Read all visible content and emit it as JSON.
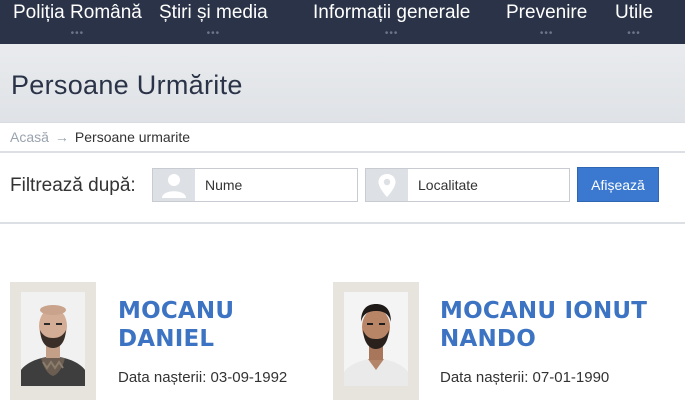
{
  "nav": {
    "items": [
      {
        "label": "Poliția Română"
      },
      {
        "label": "Știri și media"
      },
      {
        "label": "Informații generale"
      },
      {
        "label": "Prevenire"
      },
      {
        "label": "Utile"
      }
    ],
    "dots": "•••"
  },
  "page": {
    "title": "Persoane Urmărite"
  },
  "breadcrumb": {
    "home": "Acasă",
    "separator": "→",
    "current": "Persoane urmarite"
  },
  "filter": {
    "label": "Filtrează după:",
    "name_placeholder": "Nume",
    "locality_placeholder": "Localitate",
    "button_label": "Afișează"
  },
  "persons": [
    {
      "name_line1": "MOCANU",
      "name_line2": "DANIEL",
      "dob_label": "Data nașterii:",
      "dob": "03-09-1992"
    },
    {
      "name_line1": "MOCANU IONUT",
      "name_line2": "NANDO",
      "dob_label": "Data nașterii:",
      "dob": "07-01-1990"
    }
  ],
  "colors": {
    "nav_bg": "#2a3347",
    "accent": "#3a79cf",
    "name": "#3c73c2"
  }
}
